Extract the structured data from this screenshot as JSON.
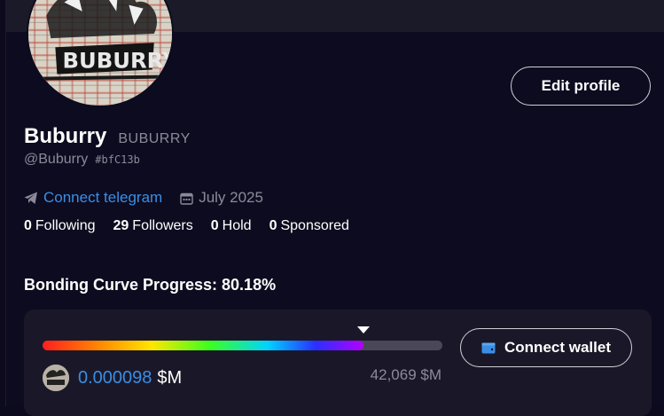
{
  "profile": {
    "display_name": "Buburry",
    "ticker": "BUBURRY",
    "handle": "@Buburry",
    "short_id": "#bfC13b",
    "telegram_label": "Connect telegram",
    "joined": "July 2025",
    "edit_label": "Edit profile"
  },
  "stats": [
    {
      "count": "0",
      "label": "Following"
    },
    {
      "count": "29",
      "label": "Followers"
    },
    {
      "count": "0",
      "label": "Hold"
    },
    {
      "count": "0",
      "label": "Sponsored"
    }
  ],
  "bonding": {
    "title": "Bonding Curve Progress: 80.18%",
    "progress_pct": 80.18,
    "market_cap_value": "0.000098",
    "market_cap_unit": "$M",
    "target": "42,069 $M",
    "wallet_label": "Connect wallet"
  },
  "colors": {
    "accent_link": "#3a8ee6",
    "background": "#0d0b1f",
    "card": "#1a1828"
  },
  "icons": {
    "telegram": "telegram-icon",
    "calendar": "calendar-icon",
    "wallet": "wallet-icon"
  }
}
